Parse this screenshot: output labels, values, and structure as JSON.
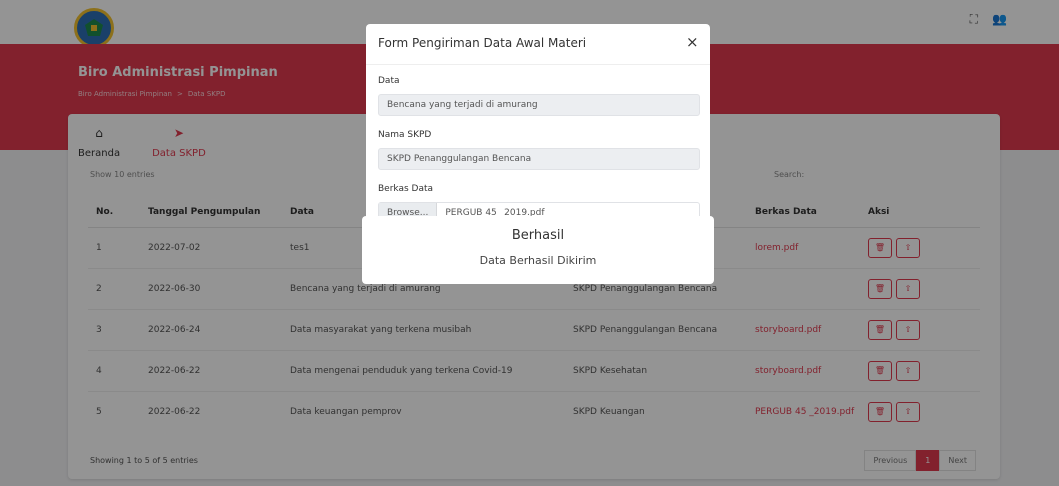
{
  "app": {
    "banner_title": "Biro Administrasi Pimpinan",
    "breadcrumb": [
      "Biro Administrasi Pimpinan",
      ">",
      "Data SKPD"
    ],
    "top_icons": [
      "fullscreen-icon",
      "user-icon"
    ]
  },
  "nav": [
    {
      "icon": "home-icon",
      "label": "Beranda"
    },
    {
      "icon": "chevron-right-icon",
      "label": "Data SKPD"
    }
  ],
  "list": {
    "show_text": "Show 10 entries",
    "search_label": "Search:",
    "columns": [
      "No.",
      "Tanggal Pengumpulan",
      "Data",
      "Nama SKPD",
      "Berkas Data",
      "Aksi"
    ],
    "rows": [
      {
        "no": "1",
        "date": "2022-07-02",
        "data": "tes1",
        "skpd": "",
        "file": "lorem.pdf"
      },
      {
        "no": "2",
        "date": "2022-06-30",
        "data": "Bencana yang terjadi di amurang",
        "skpd": "SKPD Penanggulangan Bencana",
        "file": ""
      },
      {
        "no": "3",
        "date": "2022-06-24",
        "data": "Data masyarakat yang terkena musibah",
        "skpd": "SKPD Penanggulangan Bencana",
        "file": "storyboard.pdf"
      },
      {
        "no": "4",
        "date": "2022-06-22",
        "data": "Data mengenai penduduk yang terkena Covid-19",
        "skpd": "SKPD Kesehatan",
        "file": "storyboard.pdf"
      },
      {
        "no": "5",
        "date": "2022-06-22",
        "data": "Data keuangan pemprov",
        "skpd": "SKPD Keuangan",
        "file": "PERGUB 45 _2019.pdf"
      }
    ],
    "footer_info": "Showing 1 to 5 of 5 entries",
    "pager": {
      "previous": "Previous",
      "current": "1",
      "next": "Next"
    }
  },
  "modal": {
    "title": "Form Pengiriman Data Awal Materi",
    "close": "×",
    "fields": [
      {
        "label": "Data",
        "value": "Bencana yang terjadi di amurang"
      },
      {
        "label": "Nama SKPD",
        "value": "SKPD Penanggulangan Bencana"
      }
    ],
    "file_label": "Berkas Data",
    "file_button": "Browse...",
    "file_name": "PERGUB 45 _2019.pdf"
  },
  "alert": {
    "title": "Berhasil",
    "message": "Data Berhasil Dikirim"
  },
  "colors": {
    "accent": "#e03a4f",
    "overlay": "rgba(0,0,0,0.42)"
  }
}
